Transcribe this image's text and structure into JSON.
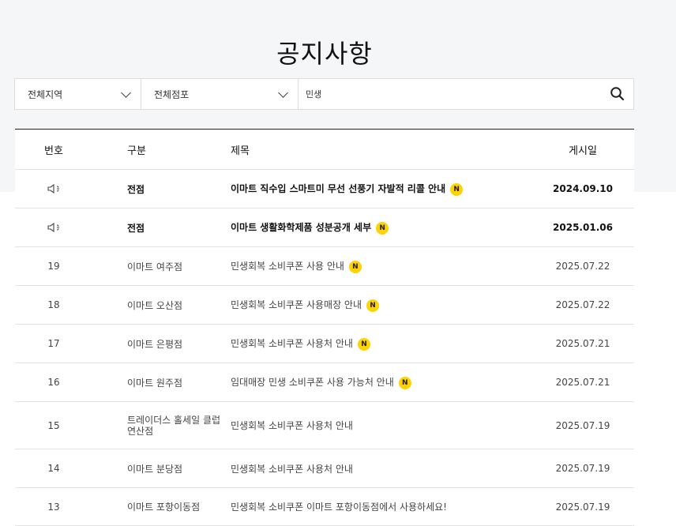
{
  "page": {
    "title": "공지사항"
  },
  "filters": {
    "region": "전체지역",
    "store": "전체점포",
    "search_value": "민생"
  },
  "table": {
    "headers": {
      "num": "번호",
      "category": "구분",
      "title": "제목",
      "date": "게시일"
    },
    "rows": [
      {
        "num": "",
        "pinned": true,
        "category": "전점",
        "title": "이마트 직수입 스마트미 무선 선풍기 자발적 리콜 안내",
        "new": "N",
        "date": "2024.09.10"
      },
      {
        "num": "",
        "pinned": true,
        "category": "전점",
        "title": "이마트 생활화학제품 성분공개 세부",
        "new": "N",
        "date": "2025.01.06"
      },
      {
        "num": "19",
        "category": "이마트 여주점",
        "title": "민생회복 소비쿠폰 사용 안내",
        "new": "N",
        "date": "2025.07.22"
      },
      {
        "num": "18",
        "category": "이마트 오산점",
        "title": "민생회복 소비쿠폰 사용매장 안내",
        "new": "N",
        "date": "2025.07.22"
      },
      {
        "num": "17",
        "category": "이마트 은평점",
        "title": "민생회복 소비쿠폰 사용처 안내",
        "new": "N",
        "date": "2025.07.21"
      },
      {
        "num": "16",
        "category": "이마트 원주점",
        "title": "임대매장 민생 소비쿠폰 사용 가능처 안내",
        "new": "N",
        "date": "2025.07.21"
      },
      {
        "num": "15",
        "category": "트레이더스 홀세일 클럽 연산점",
        "title": "민생회복 소비쿠폰 사용처 안내",
        "new": "",
        "date": "2025.07.19"
      },
      {
        "num": "14",
        "category": "이마트 분당점",
        "title": "민생회복 소비쿠폰 사용처 안내",
        "new": "",
        "date": "2025.07.19"
      },
      {
        "num": "13",
        "category": "이마트 포항이동점",
        "title": "민생회복 소비쿠폰 이마트 포항이동점에서 사용하세요!",
        "new": "",
        "date": "2025.07.19"
      }
    ]
  },
  "icons": {
    "pinned": "speaker-icon",
    "search": "search-icon",
    "dropdown": "chevron-down-icon"
  },
  "colors": {
    "new_badge": "#ffd200",
    "background_band": "#f5f6f8"
  }
}
